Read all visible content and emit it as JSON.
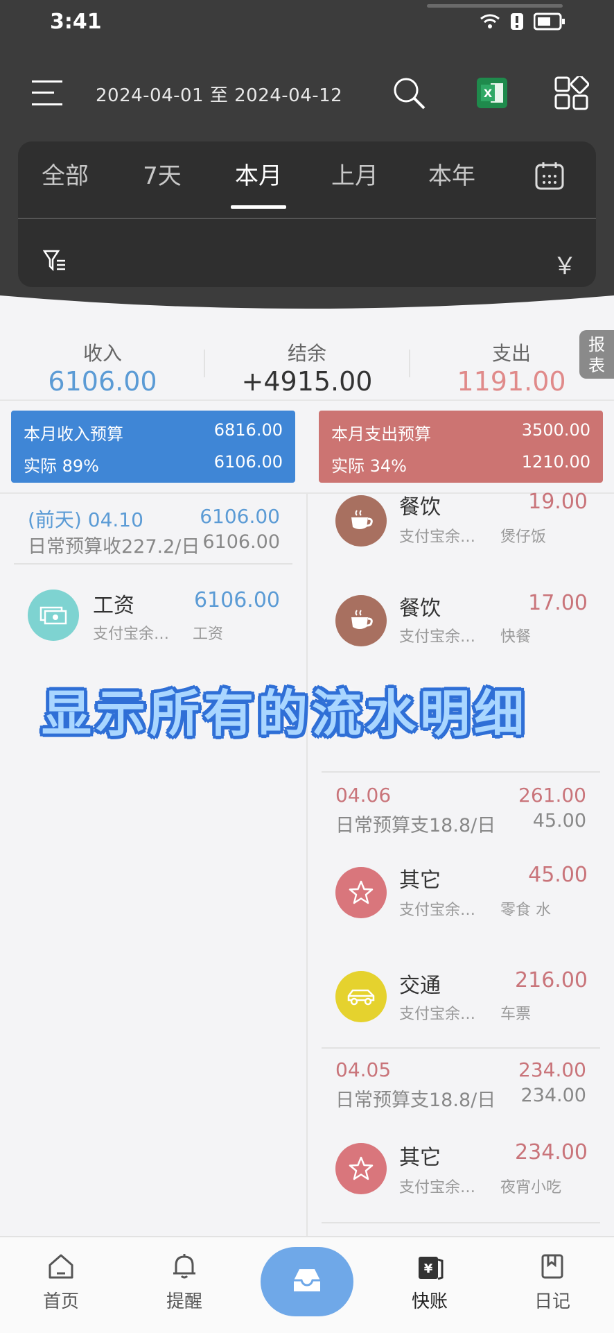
{
  "status": {
    "time": "3:41"
  },
  "header": {
    "date_range": "2024-04-01 至 2024-04-12",
    "tabs": [
      "全部",
      "7天",
      "本月",
      "上月",
      "本年"
    ],
    "active_tab": "本月",
    "currency_symbol": "￥"
  },
  "summary": {
    "income_label": "收入",
    "income_value": "6106.00",
    "balance_label": "结余",
    "balance_value": "+4915.00",
    "expense_label": "支出",
    "expense_value": "1191.00",
    "report_tab": "报表"
  },
  "budgets": {
    "income": {
      "title": "本月收入预算",
      "budget": "6816.00",
      "actual_label": "实际 89%",
      "actual": "6106.00"
    },
    "expense": {
      "title": "本月支出预算",
      "budget": "3500.00",
      "actual_label": "实际 34%",
      "actual": "1210.00"
    }
  },
  "income_column": {
    "day": {
      "date": "(前天) 04.10",
      "amount": "6106.00",
      "sub": "日常预算收227.2/日",
      "sub_amount": "6106.00"
    },
    "items": [
      {
        "name": "工资",
        "account": "支付宝余…",
        "note": "工资",
        "amount": "6106.00",
        "icon": "money-icon"
      }
    ]
  },
  "expense_column": {
    "items_top": [
      {
        "name": "餐饮",
        "account": "支付宝余…",
        "note": "煲仔饭",
        "amount": "19.00",
        "icon": "coffee-icon"
      },
      {
        "name": "餐饮",
        "account": "支付宝余…",
        "note": "快餐",
        "amount": "17.00",
        "icon": "coffee-icon"
      }
    ],
    "day_0406": {
      "date": "04.06",
      "amount": "261.00",
      "sub": "日常预算支18.8/日",
      "sub_amount": "45.00"
    },
    "items_0406": [
      {
        "name": "其它",
        "account": "支付宝余…",
        "note": "零食 水",
        "amount": "45.00",
        "icon": "star-icon"
      },
      {
        "name": "交通",
        "account": "支付宝余…",
        "note": "车票",
        "amount": "216.00",
        "icon": "car-icon"
      }
    ],
    "day_0405": {
      "date": "04.05",
      "amount": "234.00",
      "sub": "日常预算支18.8/日",
      "sub_amount": "234.00"
    },
    "items_0405": [
      {
        "name": "其它",
        "account": "支付宝余…",
        "note": "夜宵小吃",
        "amount": "234.00",
        "icon": "star-icon"
      }
    ]
  },
  "overlay_banner": "显示所有的流水明细",
  "bottom_nav": [
    {
      "label": "首页",
      "icon": "home-icon"
    },
    {
      "label": "提醒",
      "icon": "bell-icon"
    },
    {
      "label": "",
      "icon": "inbox-icon"
    },
    {
      "label": "快账",
      "icon": "quick-bill-icon"
    },
    {
      "label": "日记",
      "icon": "diary-icon"
    }
  ],
  "colors": {
    "income": "#5b9bd5",
    "expense": "#c9747a",
    "header": "#3c3c3c",
    "budget_income": "#3f86d6",
    "budget_expense": "#cc7472"
  }
}
